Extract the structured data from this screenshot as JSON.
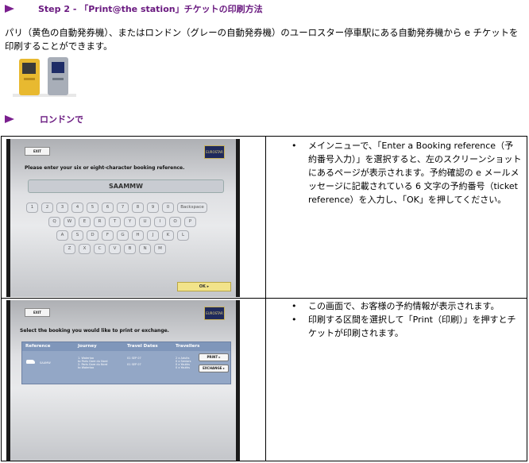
{
  "heading1": {
    "text": "Step 2 - 「Print@the station」チケットの印刷方法"
  },
  "intro": "パリ（黄色の自動発券機）、またはロンドン（グレーの自動発券機）のユーロスター停車駅にある自動発券機から e チケットを印刷することができます。",
  "heading2": {
    "text": "ロンドンで"
  },
  "screen1": {
    "exit_label": "EXIT",
    "logo_text": "EUROSTAR",
    "prompt": "Please enter your six or eight-character booking reference.",
    "booking_code": "SAAMMW",
    "keys_row1": [
      "1",
      "2",
      "3",
      "4",
      "5",
      "6",
      "7",
      "8",
      "9",
      "0"
    ],
    "backspace_label": "Backspace",
    "keys_row2": [
      "Q",
      "W",
      "E",
      "R",
      "T",
      "Y",
      "U",
      "I",
      "O",
      "P"
    ],
    "keys_row3": [
      "A",
      "S",
      "D",
      "F",
      "G",
      "H",
      "J",
      "K",
      "L"
    ],
    "keys_row4": [
      "Z",
      "X",
      "C",
      "V",
      "B",
      "N",
      "M"
    ],
    "ok_label": "OK  ▸"
  },
  "screen2": {
    "exit_label": "EXIT",
    "logo_text": "EUROSTAR",
    "prompt": "Select the booking you would like to print or exchange.",
    "columns": [
      "Reference",
      "Journey",
      "Travel Dates",
      "Travellers"
    ],
    "reference": "SAAMW",
    "journey": "1. Waterloo\nto Paris Gare du Nord\n2. Paris Gare du Nord\nto Waterloo",
    "dates": "01 SEP 07\n\n01 SEP 07",
    "travellers": "2 x Adults\n0 x Seniors\n0 x Youths\n0 x Youths",
    "print_label": "PRINT  ▸",
    "exchange_label": "EXCHANGE  ▸"
  },
  "bullets1": [
    "メインニューで、「Enter a Booking reference（予約番号入力）」を選択すると、左のスクリーンショットにあるページが表示されます。予約確認の e メールメッセージに記載されている 6 文字の予約番号（ticket reference）を入力し、「OK」を押してください。"
  ],
  "bullets2": [
    "この画面で、お客様の予約情報が表示されます。",
    "印刷する区間を選択して「Print（印刷）」を押すとチケットが印刷されます。"
  ]
}
